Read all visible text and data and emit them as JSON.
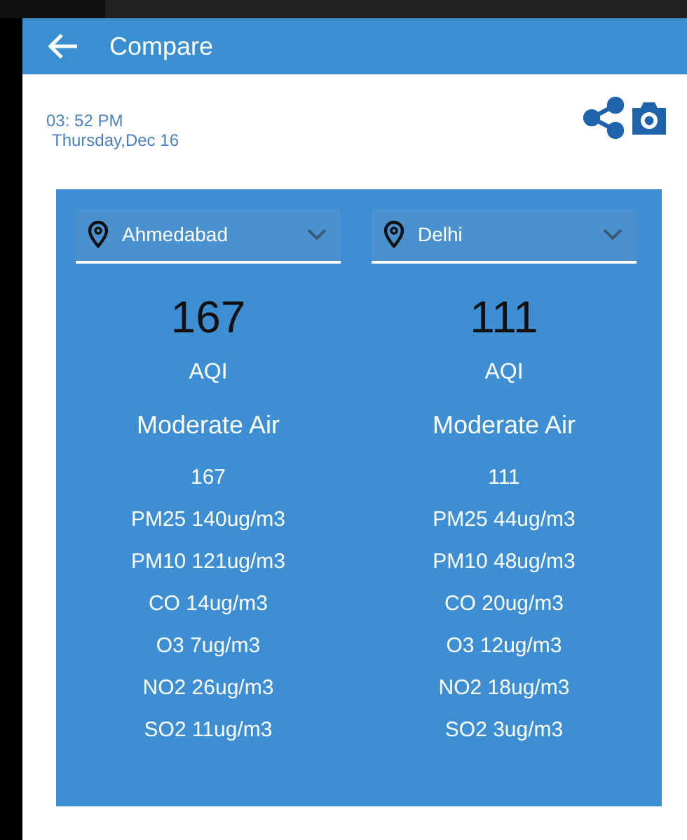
{
  "header": {
    "title": "Compare"
  },
  "timestamp": {
    "time": "03: 52 PM",
    "date": "Thursday,Dec 16"
  },
  "cities": [
    {
      "name": "Ahmedabad",
      "aqi": "167",
      "aqi_label": "AQI",
      "category": "Moderate Air",
      "readings": [
        "167",
        "PM25 140ug/m3",
        "PM10 121ug/m3",
        "CO 14ug/m3",
        "O3 7ug/m3",
        "NO2 26ug/m3",
        "SO2 11ug/m3"
      ]
    },
    {
      "name": "Delhi",
      "aqi": "111",
      "aqi_label": "AQI",
      "category": "Moderate Air",
      "readings": [
        "111",
        "PM25 44ug/m3",
        "PM10 48ug/m3",
        "CO 20ug/m3",
        "O3 12ug/m3",
        "NO2 18ug/m3",
        "SO2 3ug/m3"
      ]
    }
  ]
}
